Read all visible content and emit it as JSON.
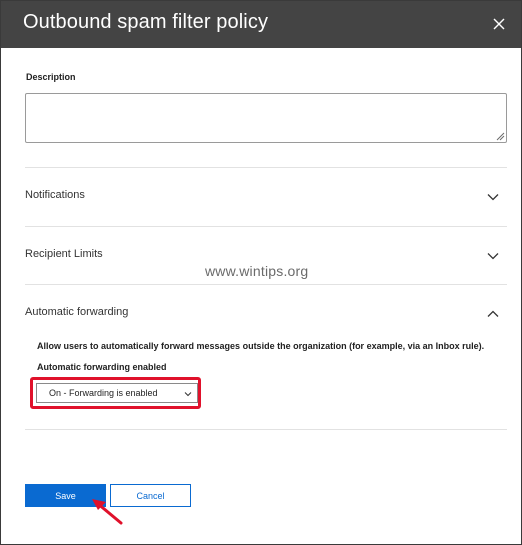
{
  "window": {
    "title": "Outbound spam filter policy",
    "close_icon": "close-icon"
  },
  "description": {
    "label": "Description",
    "value": ""
  },
  "sections": {
    "notifications": {
      "label": "Notifications",
      "expanded": false
    },
    "recipient_limits": {
      "label": "Recipient Limits",
      "expanded": false
    },
    "automatic_forwarding": {
      "label": "Automatic forwarding",
      "expanded": true,
      "description": "Allow users to automatically forward messages outside the organization (for example, via an Inbox rule).",
      "field_label": "Automatic forwarding enabled",
      "selected_option": "On - Forwarding is enabled"
    }
  },
  "buttons": {
    "save": "Save",
    "cancel": "Cancel"
  },
  "watermark": "www.wintips.org",
  "colors": {
    "titlebar": "#444444",
    "accent": "#0a6ad1",
    "highlight": "#e0112b"
  }
}
